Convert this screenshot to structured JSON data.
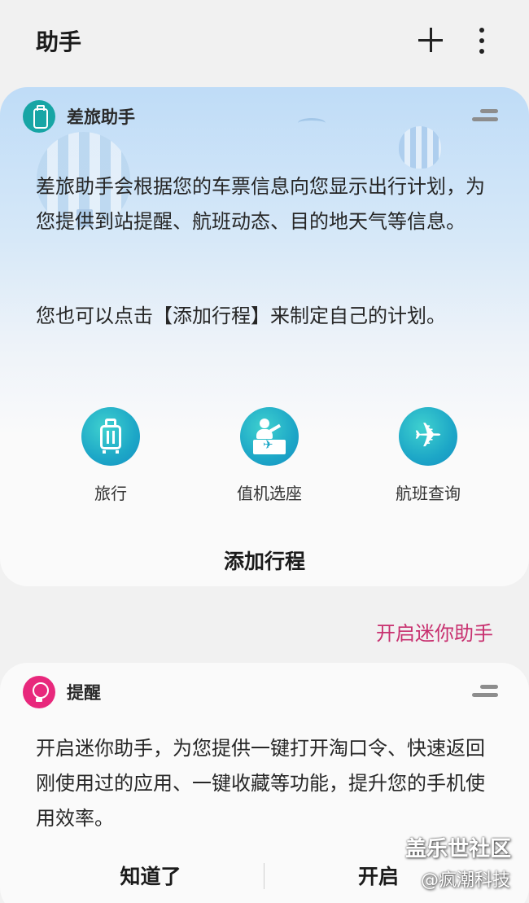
{
  "header": {
    "title": "助手",
    "add_icon": "plus-icon",
    "more_icon": "more-vertical-icon"
  },
  "travel_card": {
    "icon": "suitcase-icon",
    "title": "差旅助手",
    "description": "差旅助手会根据您的车票信息向您显示出行计划，为您提供到站提醒、航班动态、目的地天气等信息。",
    "tip": "您也可以点击【添加行程】来制定自己的计划。",
    "shortcuts": [
      {
        "icon": "suitcase-icon",
        "label": "旅行"
      },
      {
        "icon": "check-in-counter-icon",
        "label": "值机选座"
      },
      {
        "icon": "airplane-icon",
        "label": "航班查询"
      }
    ],
    "add_trip_label": "添加行程"
  },
  "enable_mini_link": "开启迷你助手",
  "reminder_card": {
    "icon": "lightbulb-icon",
    "title": "提醒",
    "description": "开启迷你助手，为您提供一键打开淘口令、快速返回刚使用过的应用、一键收藏等功能，提升您的手机使用效率。",
    "dismiss_label": "知道了",
    "enable_label": "开启"
  },
  "watermarks": {
    "line1": "盖乐世社区",
    "line2": "@疯潮科技"
  },
  "colors": {
    "accent_teal": "#17a5a5",
    "accent_pink": "#e8287c",
    "link_pink": "#c8306f"
  }
}
